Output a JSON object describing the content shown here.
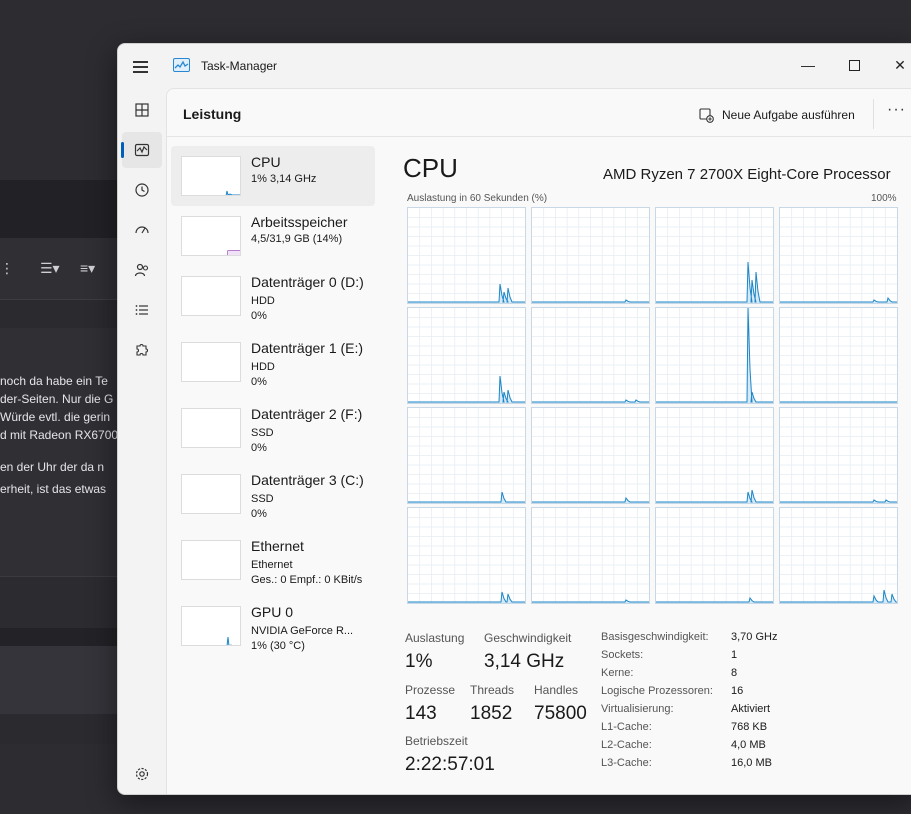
{
  "background_app": {
    "lines": [
      "noch da habe ein Te",
      "der-Seiten. Nur die G",
      "Würde evtl. die gerin",
      "d mit Radeon RX6700",
      "en der Uhr der da n",
      "erheit, ist das etwas"
    ]
  },
  "window": {
    "title": "Task-Manager",
    "minimize": "—",
    "maximize": "☐",
    "close": "✕"
  },
  "header": {
    "page_title": "Leistung",
    "new_task_label": "Neue Aufgabe ausführen",
    "more_label": "···"
  },
  "nav": {
    "items": [
      "processes",
      "performance",
      "app-history",
      "startup-apps",
      "users",
      "details",
      "services"
    ],
    "active": "performance",
    "settings": "settings"
  },
  "devices": [
    {
      "name": "CPU",
      "line1": "1% 3,14 GHz",
      "line2": ""
    },
    {
      "name": "Arbeitsspeicher",
      "line1": "4,5/31,9 GB (14%)",
      "line2": ""
    },
    {
      "name": "Datenträger 0 (D:)",
      "line1": "HDD",
      "line2": "0%"
    },
    {
      "name": "Datenträger 1 (E:)",
      "line1": "HDD",
      "line2": "0%"
    },
    {
      "name": "Datenträger 2 (F:)",
      "line1": "SSD",
      "line2": "0%"
    },
    {
      "name": "Datenträger 3 (C:)",
      "line1": "SSD",
      "line2": "0%"
    },
    {
      "name": "Ethernet",
      "line1": "Ethernet",
      "line2": "Ges.: 0 Empf.: 0 KBit/s"
    },
    {
      "name": "GPU 0",
      "line1": "NVIDIA GeForce R...",
      "line2": "1% (30 °C)"
    }
  ],
  "cpu": {
    "title": "CPU",
    "model": "AMD Ryzen 7 2700X Eight-Core Processor",
    "graph_label": "Auslastung in 60 Sekunden (%)",
    "graph_max": "100%",
    "stats": {
      "auslastung_label": "Auslastung",
      "auslastung": "1%",
      "geschwindigkeit_label": "Geschwindigkeit",
      "geschwindigkeit": "3,14 GHz",
      "prozesse_label": "Prozesse",
      "prozesse": "143",
      "threads_label": "Threads",
      "threads": "1852",
      "handles_label": "Handles",
      "handles": "75800",
      "betriebszeit_label": "Betriebszeit",
      "betriebszeit": "2:22:57:01"
    },
    "details": [
      {
        "k": "Basisgeschwindigkeit:",
        "v": "3,70 GHz"
      },
      {
        "k": "Sockets:",
        "v": "1"
      },
      {
        "k": "Kerne:",
        "v": "8"
      },
      {
        "k": "Logische Prozessoren:",
        "v": "16"
      },
      {
        "k": "Virtualisierung:",
        "v": "Aktiviert"
      },
      {
        "k": "L1-Cache:",
        "v": "768 KB"
      },
      {
        "k": "L2-Cache:",
        "v": "4,0 MB"
      },
      {
        "k": "L3-Cache:",
        "v": "16,0 MB"
      }
    ]
  },
  "colors": {
    "accent": "#005fb8",
    "cpu_line": "#1c86c8",
    "cpu_fill": "#d6e9f6",
    "memory_line": "#8b2fb1",
    "grid": "#e4ecf2"
  }
}
